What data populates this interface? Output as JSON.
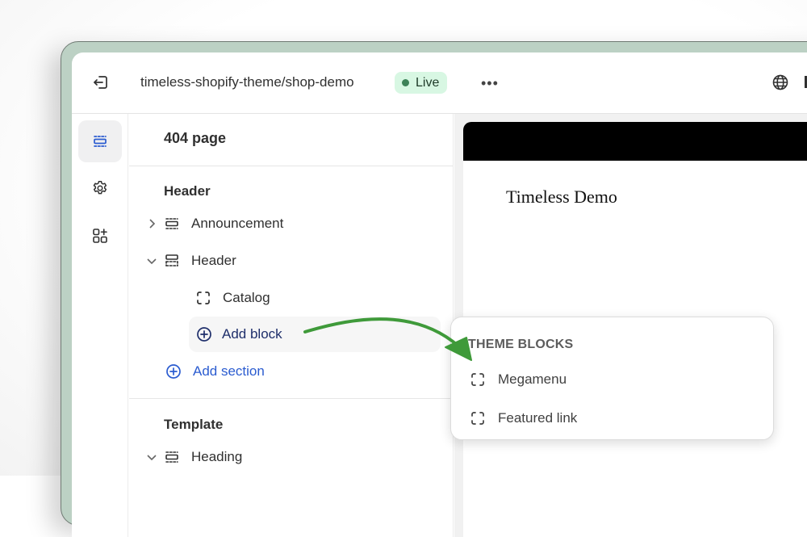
{
  "topbar": {
    "store_path": "timeless-shopify-theme/shop-demo",
    "status_badge": "Live",
    "more_label": "•••",
    "icons": [
      "exit-icon",
      "more-icon",
      "globe-icon"
    ]
  },
  "rail": {
    "items": [
      {
        "name": "sections",
        "icon": "sections-icon",
        "active": true
      },
      {
        "name": "theme-settings",
        "icon": "gear-icon",
        "active": false
      },
      {
        "name": "apps",
        "icon": "apps-add-icon",
        "active": false
      }
    ]
  },
  "panel": {
    "title": "404 page",
    "header_group": {
      "label": "Header",
      "items": [
        {
          "label": "Announcement",
          "expanded": false,
          "icon": "section-icon"
        },
        {
          "label": "Header",
          "expanded": true,
          "icon": "header-section-icon"
        }
      ],
      "blocks": [
        {
          "label": "Catalog",
          "icon": "block-icon"
        }
      ],
      "add_block_label": "Add block",
      "add_section_label": "Add section"
    },
    "template_group": {
      "label": "Template",
      "items": [
        {
          "label": "Heading",
          "expanded": true,
          "icon": "section-icon"
        }
      ]
    }
  },
  "preview": {
    "store_name": "Timeless Demo"
  },
  "popover": {
    "heading": "THEME BLOCKS",
    "items": [
      {
        "label": "Megamenu",
        "icon": "block-icon"
      },
      {
        "label": "Featured link",
        "icon": "block-icon"
      }
    ]
  },
  "colors": {
    "accent_blue": "#2b5cd0",
    "live_badge_bg": "#d8f7e3",
    "live_dot": "#3d8258",
    "annotation_arrow": "#3f9a3a",
    "frame_green": "#bcd1c4"
  }
}
